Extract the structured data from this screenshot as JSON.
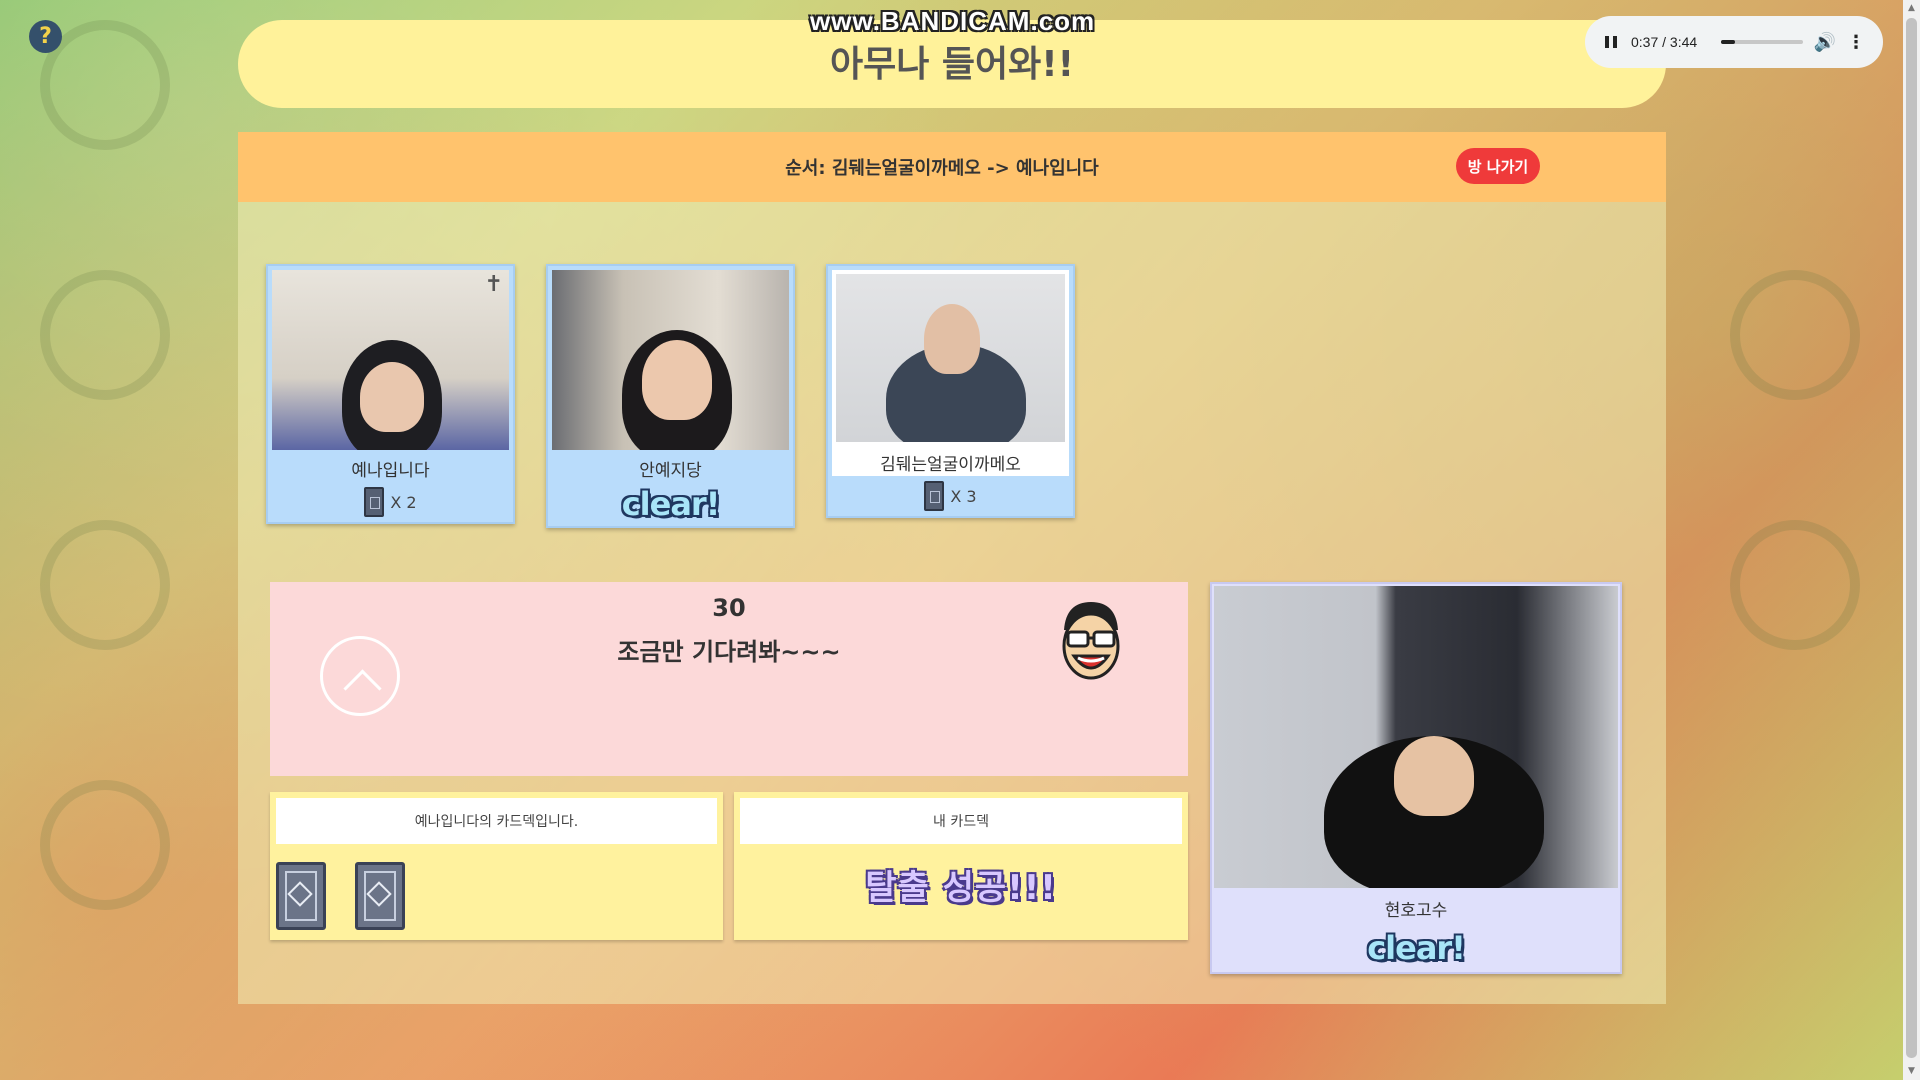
{
  "watermark": "www.BANDICAM.com",
  "help_icon": "?",
  "title": "아무나 들어와!!",
  "player": {
    "time": "0:37 / 3:44",
    "progress": 0.165
  },
  "order": {
    "text": "순서: 김뒈는얼굴이까메오 -> 예나입니다",
    "leave_label": "방 나가기"
  },
  "players": [
    {
      "name": "예나입니다",
      "status": "cards",
      "card_count": "X 2",
      "marker": "✝"
    },
    {
      "name": "안예지당",
      "status": "clear",
      "clear_label": "clear!"
    },
    {
      "name": "김뒈는얼굴이까메오",
      "status": "cards",
      "card_count": "X 3"
    }
  ],
  "timer": {
    "count": "30",
    "message": "조금만 기다려봐~~~"
  },
  "decks": {
    "other_title": "예나입니다의 카드덱입니다.",
    "mine_title": "내 카드덱",
    "mine_status": "탈출 성공!!!"
  },
  "main_player": {
    "name": "현호고수",
    "clear_label": "clear!"
  },
  "colors": {
    "accent_red": "#ef3a3a",
    "title_yellow": "#fff29a",
    "order_orange": "#ffc36d",
    "card_blue": "#b9dcfb",
    "timer_pink": "#fcd9d9"
  }
}
